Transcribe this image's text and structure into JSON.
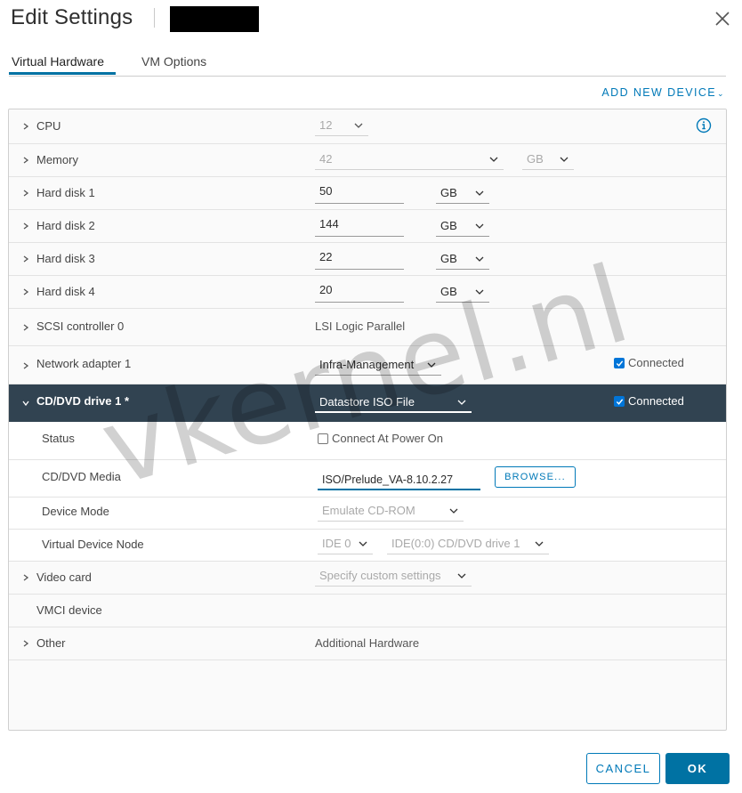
{
  "dialog": {
    "title": "Edit Settings",
    "close_icon": "close-icon"
  },
  "tabs": [
    {
      "label": "Virtual Hardware",
      "active": true
    },
    {
      "label": "VM Options",
      "active": false
    }
  ],
  "add_new_device": {
    "label": "ADD NEW DEVICE",
    "icon": "chevron-down-icon"
  },
  "hardware": {
    "cpu": {
      "label": "CPU",
      "value": "12"
    },
    "memory": {
      "label": "Memory",
      "value": "42",
      "unit": "GB"
    },
    "hard_disks": [
      {
        "label": "Hard disk 1",
        "value": "50",
        "unit": "GB"
      },
      {
        "label": "Hard disk 2",
        "value": "144",
        "unit": "GB"
      },
      {
        "label": "Hard disk 3",
        "value": "22",
        "unit": "GB"
      },
      {
        "label": "Hard disk 4",
        "value": "20",
        "unit": "GB"
      }
    ],
    "scsi": {
      "label": "SCSI controller 0",
      "value": "LSI Logic Parallel"
    },
    "network": {
      "label": "Network adapter 1",
      "value": "Infra-Management",
      "connected_label": "Connected",
      "connected": true
    },
    "cddvd": {
      "label": "CD/DVD drive 1 *",
      "value": "Datastore ISO File",
      "connected_label": "Connected",
      "connected": true,
      "status": {
        "label": "Status",
        "checkbox_label": "Connect At Power On",
        "checked": false
      },
      "media": {
        "label": "CD/DVD Media",
        "value": "ISO/Prelude_VA-8.10.2.27",
        "browse_label": "BROWSE..."
      },
      "device_mode": {
        "label": "Device Mode",
        "value": "Emulate CD-ROM"
      },
      "virtual_device_node": {
        "label": "Virtual Device Node",
        "bus": "IDE 0",
        "node": "IDE(0:0) CD/DVD drive 1"
      }
    },
    "video": {
      "label": "Video card",
      "value": "Specify custom settings"
    },
    "vmci": {
      "label": "VMCI device"
    },
    "other": {
      "label": "Other",
      "value": "Additional Hardware"
    }
  },
  "watermark": "vkernel.nl",
  "footer": {
    "cancel_label": "CANCEL",
    "ok_label": "OK"
  },
  "colors": {
    "accent": "#0072a3",
    "link": "#0079b8",
    "selected_row": "#314351"
  }
}
